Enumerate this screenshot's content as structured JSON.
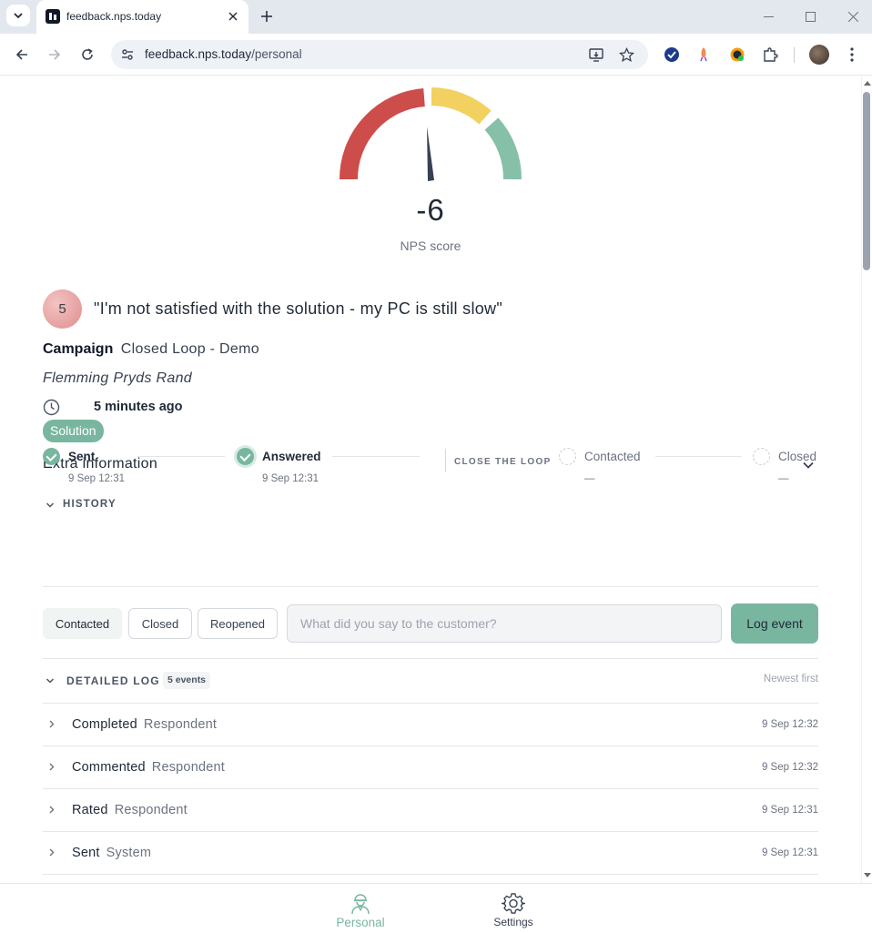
{
  "browser": {
    "tab_title": "feedback.nps.today",
    "url_host": "feedback.nps.today",
    "url_path": "/personal"
  },
  "nps": {
    "score": "-6",
    "label": "NPS score",
    "gauge_colors": {
      "detractor": "#cd4d4a",
      "passive": "#f2d160",
      "promoter": "#86c0a8",
      "needle": "#374151"
    }
  },
  "response": {
    "rating": "5",
    "comment": "\"I'm not satisfied with the solution - my PC is still slow\"",
    "campaign_key": "Campaign",
    "campaign_value": "Closed Loop - Demo",
    "respondent": "Flemming Pryds Rand",
    "time_ago": "5 minutes ago",
    "tag": "Solution"
  },
  "extra_info": {
    "label": "Extra information"
  },
  "history": {
    "title": "HISTORY",
    "close_loop_label": "CLOSE THE LOOP",
    "steps": [
      {
        "label": "Sent",
        "date": "9 Sep 12:31",
        "status": "done"
      },
      {
        "label": "Answered",
        "date": "9 Sep 12:31",
        "status": "done"
      },
      {
        "label": "Contacted",
        "date": "—",
        "status": "pending"
      },
      {
        "label": "Closed",
        "date": "—",
        "status": "pending"
      }
    ]
  },
  "actions": {
    "buttons": [
      "Contacted",
      "Closed",
      "Reopened"
    ],
    "selected": "Contacted",
    "input_placeholder": "What did you say to the customer?",
    "input_value": "",
    "log_button": "Log event"
  },
  "detailed_log": {
    "title": "DETAILED LOG",
    "count": "5 events",
    "sort": "Newest first",
    "rows": [
      {
        "event": "Completed",
        "actor": "Respondent",
        "time": "9 Sep 12:32"
      },
      {
        "event": "Commented",
        "actor": "Respondent",
        "time": "9 Sep 12:32"
      },
      {
        "event": "Rated",
        "actor": "Respondent",
        "time": "9 Sep 12:31"
      },
      {
        "event": "Sent",
        "actor": "System",
        "time": "9 Sep 12:31"
      }
    ]
  },
  "bottom_nav": {
    "items": [
      {
        "label": "Personal",
        "icon": "person-icon",
        "active": true
      },
      {
        "label": "Settings",
        "icon": "gear-icon",
        "active": false
      }
    ]
  },
  "colors": {
    "accent": "#79b6a0"
  }
}
